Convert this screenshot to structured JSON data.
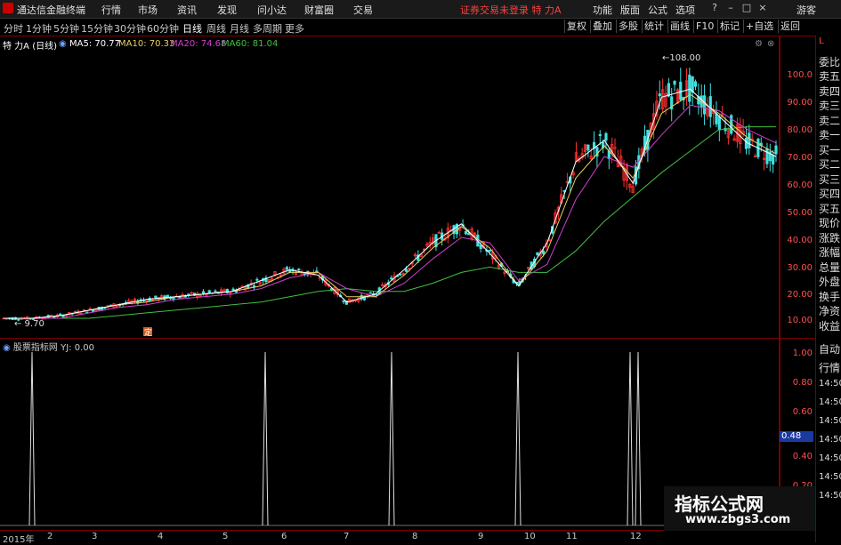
{
  "titlebar": {
    "app_title": "通达信金融终端",
    "menus": [
      "行情",
      "市场",
      "资讯",
      "发现",
      "问小达",
      "财富圈",
      "交易"
    ],
    "notice": "证券交易未登录  特 力A",
    "right_menus": [
      "功能",
      "版面",
      "公式",
      "选项"
    ],
    "user": "游客"
  },
  "toolbar": {
    "periods": [
      "分时",
      "1分钟",
      "5分钟",
      "15分钟",
      "30分钟",
      "60分钟",
      "日线",
      "周线",
      "月线",
      "多周期",
      "更多"
    ],
    "active_period": "日线",
    "right_buttons": [
      "复权",
      "叠加",
      "多股",
      "统计",
      "画线",
      "F10",
      "标记",
      "+自选",
      "返回"
    ]
  },
  "stock": {
    "name": "特 力A",
    "period_tag": "(日线)",
    "ma5": "MA5: 70.77",
    "ma10": "MA10: 70.33",
    "ma20": "MA20: 74.68",
    "ma60": "MA60: 81.04"
  },
  "colors": {
    "ma5": "#ffffff",
    "ma10": "#e8d060",
    "ma20": "#d040d0",
    "ma60": "#40c040",
    "up": "#ff3030",
    "down": "#40e0e0",
    "axis_text": "#ff5050"
  },
  "price_axis": [
    "100.0",
    "90.00",
    "80.00",
    "70.00",
    "60.00",
    "50.00",
    "40.00",
    "30.00",
    "20.00",
    "10.00"
  ],
  "annotations": {
    "high": "108.00",
    "low": "9.70",
    "marker": "定"
  },
  "side_panel": [
    "L",
    "委比",
    "卖五",
    "卖四",
    "卖三",
    "卖二",
    "卖一",
    "买一",
    "买二",
    "买三",
    "买四",
    "买五",
    "现价",
    "涨跌",
    "涨幅",
    "总量",
    "外盘",
    "换手",
    "净资",
    "收益",
    "自动",
    "行情",
    "14:50",
    "14:50",
    "14:50",
    "14:50",
    "14:50",
    "14:50",
    "14:50"
  ],
  "sub_chart": {
    "title": "股票指标网  YJ: 0.00",
    "axis": [
      "1.00",
      "0.80",
      "0.60",
      "0.40",
      "0.20"
    ],
    "cursor_value": "0.48"
  },
  "date_axis": [
    "2015年",
    "2",
    "3",
    "4",
    "5",
    "6",
    "7",
    "8",
    "9",
    "10",
    "11",
    "12"
  ],
  "watermark": {
    "line1": "指标公式网",
    "line2": "www.zbgs3.com"
  },
  "chart_data": {
    "type": "line",
    "title": "",
    "xlabel": "",
    "ylabel": "",
    "ylim": [
      0,
      110
    ],
    "x": [
      0,
      10,
      20,
      30,
      40,
      50,
      60,
      70,
      80,
      90,
      100,
      110,
      120,
      130,
      140,
      150,
      160,
      170,
      180,
      190,
      200,
      210,
      220,
      230,
      240
    ],
    "series": [
      {
        "name": "MA5",
        "values": [
          10,
          10,
          11,
          13,
          15,
          17,
          18,
          19,
          20,
          24,
          28,
          26,
          16,
          19,
          28,
          38,
          45,
          34,
          22,
          38,
          68,
          76,
          60,
          92,
          95,
          85,
          75,
          70
        ]
      },
      {
        "name": "MA10",
        "values": [
          10,
          10,
          11,
          13,
          15,
          16,
          18,
          19,
          20,
          22,
          27,
          27,
          18,
          18,
          26,
          36,
          44,
          36,
          22,
          35,
          62,
          74,
          62,
          86,
          93,
          86,
          77,
          71
        ]
      },
      {
        "name": "MA20",
        "values": [
          10,
          10,
          10,
          12,
          14,
          15,
          17,
          18,
          19,
          21,
          25,
          27,
          21,
          18,
          23,
          32,
          40,
          38,
          24,
          30,
          54,
          70,
          66,
          78,
          89,
          87,
          80,
          75
        ]
      },
      {
        "name": "MA60",
        "values": [
          10,
          10,
          10,
          10,
          11,
          12,
          13,
          14,
          15,
          16,
          18,
          20,
          21,
          20,
          20,
          23,
          27,
          29,
          27,
          27,
          35,
          46,
          55,
          64,
          72,
          80,
          81,
          81
        ]
      }
    ],
    "indicator": {
      "name": "YJ",
      "spikes_at_month": [
        1,
        6,
        8,
        10,
        12
      ],
      "value_range": [
        0,
        1
      ]
    }
  }
}
